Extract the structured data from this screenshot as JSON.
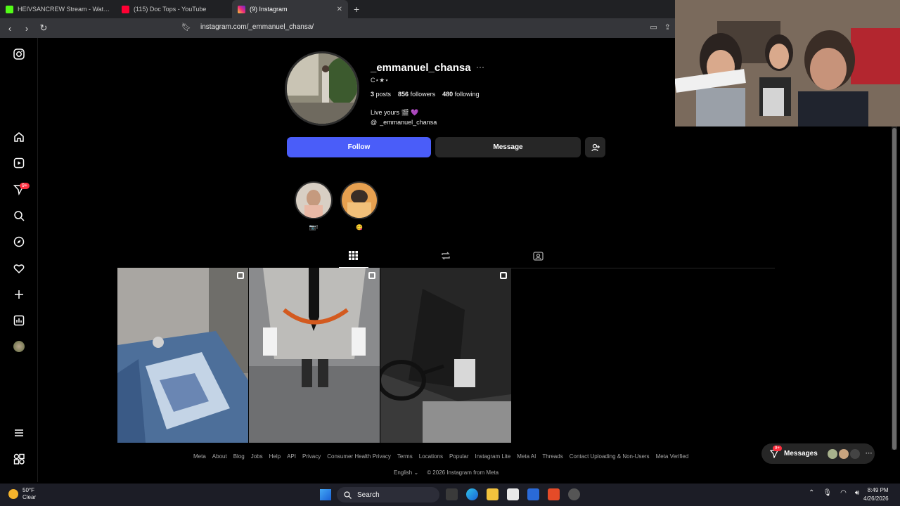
{
  "browser": {
    "tabs": [
      {
        "title": "HEIVSANCREW Stream - Watch l...",
        "favicon_color": "#53fc18"
      },
      {
        "title": "(115) Doc Tops - YouTube",
        "favicon_color": "#ff0033"
      },
      {
        "title": "(9) Instagram",
        "favicon_color": "#e1306c",
        "active": true
      }
    ],
    "new_tab": "+",
    "url": "instagram.com/_emmanuel_chansa/"
  },
  "sidebar": {
    "icons": [
      "instagram-icon",
      "home-icon",
      "reels-icon",
      "messages-icon",
      "search-icon",
      "explore-icon",
      "notifications-icon",
      "create-icon",
      "dashboard-icon",
      "profile-icon",
      "more-icon",
      "also-from-meta-icon"
    ],
    "messages_badge": "9+"
  },
  "profile": {
    "username": "_emmanuel_chansa",
    "more": "···",
    "full_name": "C⋆★⋆",
    "posts_count": "3",
    "posts_label": "posts",
    "followers_count": "856",
    "followers_label": "followers",
    "following_count": "480",
    "following_label": "following",
    "bio": "Live yours 🎬 💜",
    "threads_handle": "_emmanuel_chansa",
    "follow_label": "Follow",
    "message_label": "Message",
    "add_user_label": "+"
  },
  "highlights": [
    {
      "label": "📷!"
    },
    {
      "label": "😋"
    }
  ],
  "tabs": {
    "icons": [
      "posts-grid-icon",
      "reposts-icon",
      "tagged-icon"
    ],
    "active": "posts"
  },
  "posts": [
    {
      "subject": "denim-bandana-outfit",
      "multi": true
    },
    {
      "subject": "san-francisco-jersey",
      "multi": true
    },
    {
      "subject": "bw-glasses-suit",
      "multi": true
    }
  ],
  "footer": {
    "links": [
      "Meta",
      "About",
      "Blog",
      "Jobs",
      "Help",
      "API",
      "Privacy",
      "Consumer Health Privacy",
      "Terms",
      "Locations",
      "Popular",
      "Instagram Lite",
      "Meta AI",
      "Threads",
      "Contact Uploading & Non-Users",
      "Meta Verified"
    ],
    "language": "English",
    "copyright": "© 2026 Instagram from Meta"
  },
  "messages_pill": {
    "label": "Messages",
    "badge": "9+"
  },
  "taskbar": {
    "weather_temp": "50°F",
    "weather_cond": "Clear",
    "search_label": "Search",
    "time": "8:49 PM",
    "date": "4/26/2026"
  },
  "colors": {
    "follow_blue": "#4a5df9",
    "badge_red": "#ff3040",
    "button_gray": "#262626"
  }
}
